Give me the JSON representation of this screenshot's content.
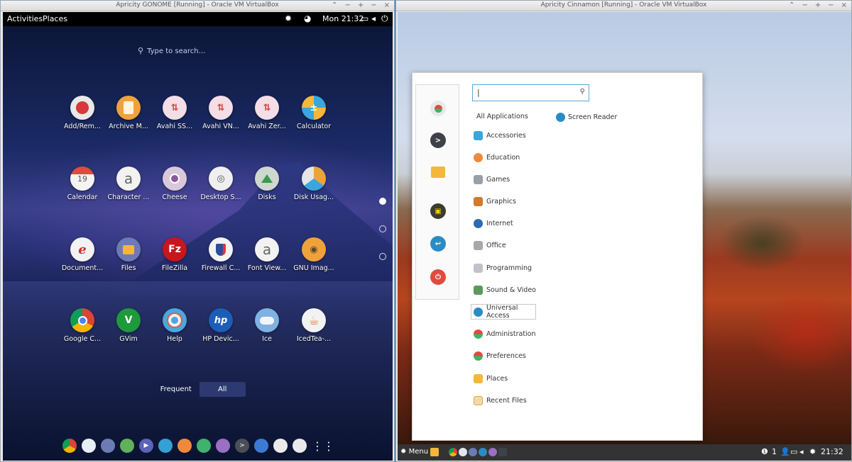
{
  "left_window": {
    "title": "Apricity GONOME [Running] - Oracle VM VirtualBox",
    "controls": [
      "⌃",
      "−",
      "+",
      "−",
      "×"
    ],
    "topbar": {
      "activities": "Activities",
      "places": "Places",
      "clock": "Mon 21:32"
    },
    "search_placeholder": "Type to search...",
    "apps": [
      "Add/Rem...",
      "Archive M...",
      "Avahi SS...",
      "Avahi VN...",
      "Avahi Zer...",
      "Calculator",
      "Calendar",
      "Character ...",
      "Cheese",
      "Desktop S...",
      "Disks",
      "Disk Usag...",
      "Document...",
      "Files",
      "FileZilla",
      "Firewall C...",
      "Font View...",
      "GNU Imag...",
      "Google C...",
      "GVim",
      "Help",
      "HP Devic...",
      "Ice",
      "IcedTea-..."
    ],
    "calendar_day": "19",
    "tabs": {
      "frequent": "Frequent",
      "all": "All"
    }
  },
  "right_window": {
    "title": "Apricity Cinnamon [Running] - Oracle VM VirtualBox",
    "controls": [
      "⌃",
      "−",
      "+",
      "−",
      "×"
    ],
    "search_value": "|",
    "all_applications": "All Applications",
    "screen_reader": "Screen Reader",
    "categories": [
      "Accessories",
      "Education",
      "Games",
      "Graphics",
      "Internet",
      "Office",
      "Programming",
      "Sound & Video",
      "Universal Access",
      "Administration",
      "Preferences",
      "Places",
      "Recent Files"
    ],
    "panel": {
      "menu": "Menu",
      "workspace": "1",
      "clock": "21:32"
    }
  }
}
